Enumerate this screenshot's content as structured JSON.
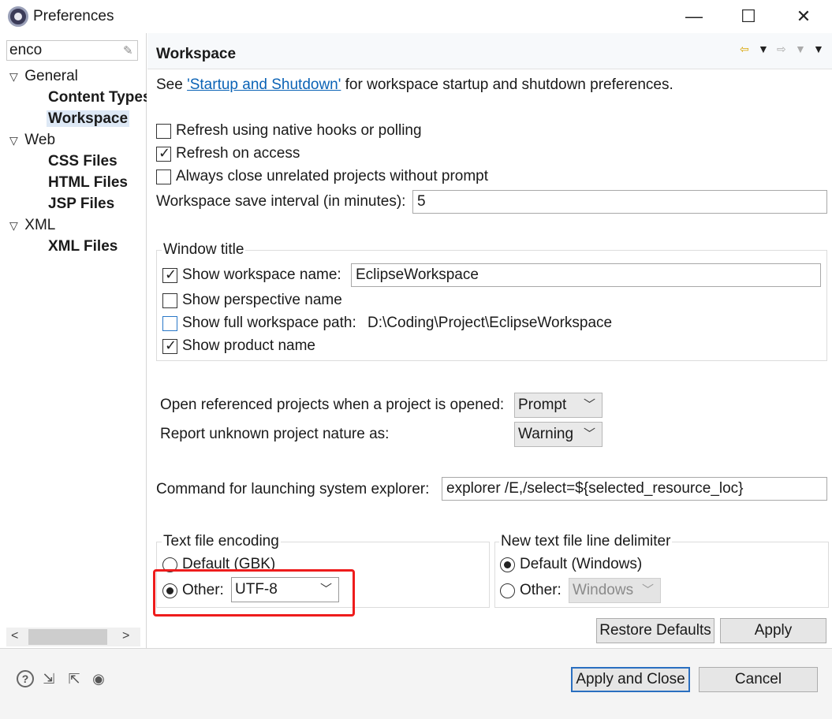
{
  "window": {
    "title": "Preferences",
    "minimize": "—",
    "maximize": "☐",
    "close": "✕"
  },
  "filter": {
    "value": "enco",
    "clear_icon": "eraser-icon"
  },
  "tree": [
    {
      "label": "General",
      "expanded": true,
      "level": 0,
      "bold": false
    },
    {
      "label": "Content Types",
      "level": 1,
      "bold": true
    },
    {
      "label": "Workspace",
      "level": 1,
      "bold": true,
      "selected": true
    },
    {
      "label": "Web",
      "expanded": true,
      "level": 0,
      "bold": false
    },
    {
      "label": "CSS Files",
      "level": 1,
      "bold": true
    },
    {
      "label": "HTML Files",
      "level": 1,
      "bold": true
    },
    {
      "label": "JSP Files",
      "level": 1,
      "bold": true
    },
    {
      "label": "XML",
      "expanded": true,
      "level": 0,
      "bold": false
    },
    {
      "label": "XML Files",
      "level": 1,
      "bold": true
    }
  ],
  "page": {
    "title": "Workspace",
    "intro_prefix": "See ",
    "intro_link": "'Startup and Shutdown'",
    "intro_suffix": " for workspace startup and shutdown preferences.",
    "options": [
      {
        "label": "Refresh using native hooks or polling",
        "checked": false
      },
      {
        "label": "Refresh on access",
        "checked": true
      },
      {
        "label": "Always close unrelated projects without prompt",
        "checked": false
      }
    ],
    "save_interval_label": "Workspace save interval (in minutes):",
    "save_interval_value": "5",
    "window_title_group": "Window title",
    "show_workspace_name": "Show workspace name:",
    "workspace_name_value": "EclipseWorkspace",
    "show_perspective_name": "Show perspective name",
    "show_full_path": "Show full workspace path:",
    "full_path_value": "D:\\Coding\\Project\\EclipseWorkspace",
    "show_product_name": "Show product name",
    "open_referenced_label": "Open referenced projects when a project is opened:",
    "open_referenced_value": "Prompt",
    "report_unknown_label": "Report unknown project nature as:",
    "report_unknown_value": "Warning",
    "explorer_label": "Command for launching system explorer:",
    "explorer_value": "explorer /E,/select=${selected_resource_loc}",
    "encoding_group": "Text file encoding",
    "encoding_default": "Default (GBK)",
    "encoding_other": "Other:",
    "encoding_other_value": "UTF-8",
    "delimiter_group": "New text file line delimiter",
    "delimiter_default": "Default (Windows)",
    "delimiter_other": "Other:",
    "delimiter_other_value": "Windows",
    "restore_defaults": "Restore Defaults",
    "apply": "Apply"
  },
  "footer": {
    "apply_and_close": "Apply and Close",
    "cancel": "Cancel",
    "icons": [
      "help-icon",
      "import-icon",
      "export-icon",
      "record-icon"
    ]
  },
  "colors": {
    "link": "#0b63b6",
    "highlight_box": "#ee1c1c",
    "default_button_border": "#2a6fc0"
  }
}
